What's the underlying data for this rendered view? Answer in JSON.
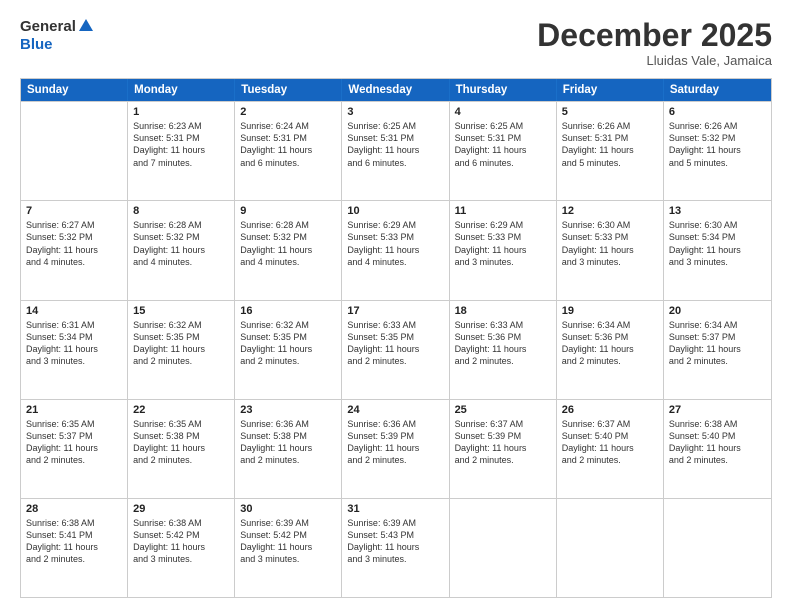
{
  "header": {
    "logo_general": "General",
    "logo_blue": "Blue",
    "month_title": "December 2025",
    "location": "Lluidas Vale, Jamaica"
  },
  "days_of_week": [
    "Sunday",
    "Monday",
    "Tuesday",
    "Wednesday",
    "Thursday",
    "Friday",
    "Saturday"
  ],
  "weeks": [
    [
      {
        "day": "",
        "lines": []
      },
      {
        "day": "1",
        "lines": [
          "Sunrise: 6:23 AM",
          "Sunset: 5:31 PM",
          "Daylight: 11 hours",
          "and 7 minutes."
        ]
      },
      {
        "day": "2",
        "lines": [
          "Sunrise: 6:24 AM",
          "Sunset: 5:31 PM",
          "Daylight: 11 hours",
          "and 6 minutes."
        ]
      },
      {
        "day": "3",
        "lines": [
          "Sunrise: 6:25 AM",
          "Sunset: 5:31 PM",
          "Daylight: 11 hours",
          "and 6 minutes."
        ]
      },
      {
        "day": "4",
        "lines": [
          "Sunrise: 6:25 AM",
          "Sunset: 5:31 PM",
          "Daylight: 11 hours",
          "and 6 minutes."
        ]
      },
      {
        "day": "5",
        "lines": [
          "Sunrise: 6:26 AM",
          "Sunset: 5:31 PM",
          "Daylight: 11 hours",
          "and 5 minutes."
        ]
      },
      {
        "day": "6",
        "lines": [
          "Sunrise: 6:26 AM",
          "Sunset: 5:32 PM",
          "Daylight: 11 hours",
          "and 5 minutes."
        ]
      }
    ],
    [
      {
        "day": "7",
        "lines": [
          "Sunrise: 6:27 AM",
          "Sunset: 5:32 PM",
          "Daylight: 11 hours",
          "and 4 minutes."
        ]
      },
      {
        "day": "8",
        "lines": [
          "Sunrise: 6:28 AM",
          "Sunset: 5:32 PM",
          "Daylight: 11 hours",
          "and 4 minutes."
        ]
      },
      {
        "day": "9",
        "lines": [
          "Sunrise: 6:28 AM",
          "Sunset: 5:32 PM",
          "Daylight: 11 hours",
          "and 4 minutes."
        ]
      },
      {
        "day": "10",
        "lines": [
          "Sunrise: 6:29 AM",
          "Sunset: 5:33 PM",
          "Daylight: 11 hours",
          "and 4 minutes."
        ]
      },
      {
        "day": "11",
        "lines": [
          "Sunrise: 6:29 AM",
          "Sunset: 5:33 PM",
          "Daylight: 11 hours",
          "and 3 minutes."
        ]
      },
      {
        "day": "12",
        "lines": [
          "Sunrise: 6:30 AM",
          "Sunset: 5:33 PM",
          "Daylight: 11 hours",
          "and 3 minutes."
        ]
      },
      {
        "day": "13",
        "lines": [
          "Sunrise: 6:30 AM",
          "Sunset: 5:34 PM",
          "Daylight: 11 hours",
          "and 3 minutes."
        ]
      }
    ],
    [
      {
        "day": "14",
        "lines": [
          "Sunrise: 6:31 AM",
          "Sunset: 5:34 PM",
          "Daylight: 11 hours",
          "and 3 minutes."
        ]
      },
      {
        "day": "15",
        "lines": [
          "Sunrise: 6:32 AM",
          "Sunset: 5:35 PM",
          "Daylight: 11 hours",
          "and 2 minutes."
        ]
      },
      {
        "day": "16",
        "lines": [
          "Sunrise: 6:32 AM",
          "Sunset: 5:35 PM",
          "Daylight: 11 hours",
          "and 2 minutes."
        ]
      },
      {
        "day": "17",
        "lines": [
          "Sunrise: 6:33 AM",
          "Sunset: 5:35 PM",
          "Daylight: 11 hours",
          "and 2 minutes."
        ]
      },
      {
        "day": "18",
        "lines": [
          "Sunrise: 6:33 AM",
          "Sunset: 5:36 PM",
          "Daylight: 11 hours",
          "and 2 minutes."
        ]
      },
      {
        "day": "19",
        "lines": [
          "Sunrise: 6:34 AM",
          "Sunset: 5:36 PM",
          "Daylight: 11 hours",
          "and 2 minutes."
        ]
      },
      {
        "day": "20",
        "lines": [
          "Sunrise: 6:34 AM",
          "Sunset: 5:37 PM",
          "Daylight: 11 hours",
          "and 2 minutes."
        ]
      }
    ],
    [
      {
        "day": "21",
        "lines": [
          "Sunrise: 6:35 AM",
          "Sunset: 5:37 PM",
          "Daylight: 11 hours",
          "and 2 minutes."
        ]
      },
      {
        "day": "22",
        "lines": [
          "Sunrise: 6:35 AM",
          "Sunset: 5:38 PM",
          "Daylight: 11 hours",
          "and 2 minutes."
        ]
      },
      {
        "day": "23",
        "lines": [
          "Sunrise: 6:36 AM",
          "Sunset: 5:38 PM",
          "Daylight: 11 hours",
          "and 2 minutes."
        ]
      },
      {
        "day": "24",
        "lines": [
          "Sunrise: 6:36 AM",
          "Sunset: 5:39 PM",
          "Daylight: 11 hours",
          "and 2 minutes."
        ]
      },
      {
        "day": "25",
        "lines": [
          "Sunrise: 6:37 AM",
          "Sunset: 5:39 PM",
          "Daylight: 11 hours",
          "and 2 minutes."
        ]
      },
      {
        "day": "26",
        "lines": [
          "Sunrise: 6:37 AM",
          "Sunset: 5:40 PM",
          "Daylight: 11 hours",
          "and 2 minutes."
        ]
      },
      {
        "day": "27",
        "lines": [
          "Sunrise: 6:38 AM",
          "Sunset: 5:40 PM",
          "Daylight: 11 hours",
          "and 2 minutes."
        ]
      }
    ],
    [
      {
        "day": "28",
        "lines": [
          "Sunrise: 6:38 AM",
          "Sunset: 5:41 PM",
          "Daylight: 11 hours",
          "and 2 minutes."
        ]
      },
      {
        "day": "29",
        "lines": [
          "Sunrise: 6:38 AM",
          "Sunset: 5:42 PM",
          "Daylight: 11 hours",
          "and 3 minutes."
        ]
      },
      {
        "day": "30",
        "lines": [
          "Sunrise: 6:39 AM",
          "Sunset: 5:42 PM",
          "Daylight: 11 hours",
          "and 3 minutes."
        ]
      },
      {
        "day": "31",
        "lines": [
          "Sunrise: 6:39 AM",
          "Sunset: 5:43 PM",
          "Daylight: 11 hours",
          "and 3 minutes."
        ]
      },
      {
        "day": "",
        "lines": []
      },
      {
        "day": "",
        "lines": []
      },
      {
        "day": "",
        "lines": []
      }
    ]
  ]
}
